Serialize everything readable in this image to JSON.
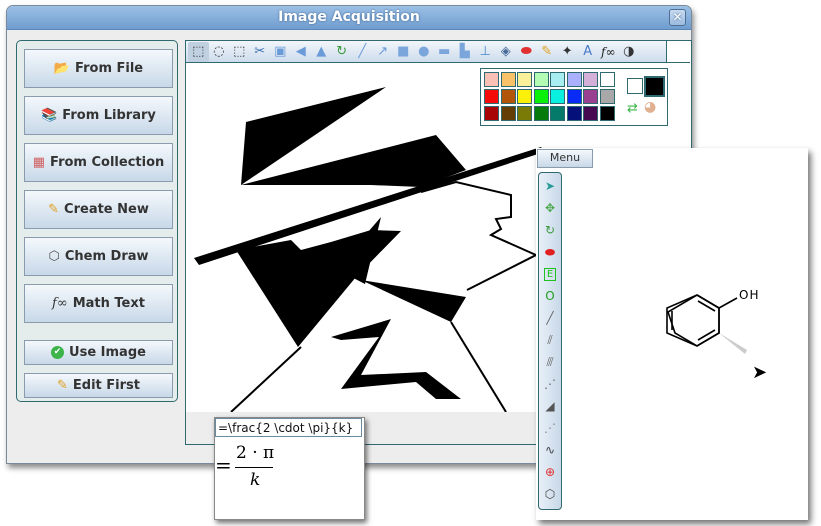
{
  "window": {
    "title": "Image Acquisition",
    "close_icon": "close-icon"
  },
  "left_panel": {
    "buttons": [
      {
        "label": "From File",
        "icon": "folder-file-icon"
      },
      {
        "label": "From Library",
        "icon": "books-icon"
      },
      {
        "label": "From Collection",
        "icon": "color-grid-icon"
      },
      {
        "label": "Create New",
        "icon": "pencil-icon"
      },
      {
        "label": "Chem Draw",
        "icon": "benzene-ring-icon"
      },
      {
        "label": "Math Text",
        "icon": "function-icon"
      },
      {
        "label": "Use Image",
        "icon": "check-circle-icon"
      },
      {
        "label": "Edit First",
        "icon": "pencil-icon"
      }
    ],
    "icon_glyphs": {
      "from_file": "📂",
      "from_library": "📚",
      "from_collection": "▦",
      "create_new": "✎",
      "chem_draw": "⬡",
      "math_text": "f∞",
      "use_image": "✔",
      "edit_first": "✎"
    }
  },
  "image_toolbar": {
    "tools": [
      {
        "name": "rectangle-select",
        "glyph": "⬚",
        "selected": true
      },
      {
        "name": "ellipse-select",
        "glyph": "◌"
      },
      {
        "name": "free-select",
        "glyph": "⬚"
      },
      {
        "name": "cut",
        "glyph": "✂"
      },
      {
        "name": "crop",
        "glyph": "▣"
      },
      {
        "name": "flip-horizontal",
        "glyph": "◀"
      },
      {
        "name": "flip-vertical",
        "glyph": "▲"
      },
      {
        "name": "rotate",
        "glyph": "↻"
      },
      {
        "name": "line",
        "glyph": "╱"
      },
      {
        "name": "arrow",
        "glyph": "↗"
      },
      {
        "name": "rectangle",
        "glyph": "■"
      },
      {
        "name": "ellipse",
        "glyph": "●"
      },
      {
        "name": "rounded-rectangle",
        "glyph": "▬"
      },
      {
        "name": "polygon",
        "glyph": "▙"
      },
      {
        "name": "stamp",
        "glyph": "⊥"
      },
      {
        "name": "fill-bucket",
        "glyph": "◈"
      },
      {
        "name": "eraser",
        "glyph": "⬬"
      },
      {
        "name": "pencil",
        "glyph": "✎"
      },
      {
        "name": "magic-wand",
        "glyph": "✦"
      },
      {
        "name": "add-text",
        "glyph": "A"
      },
      {
        "name": "math-text",
        "glyph": "f∞"
      },
      {
        "name": "contrast",
        "glyph": "◑"
      }
    ]
  },
  "palette": {
    "colors": [
      [
        "#f9c1b5",
        "#f9c168",
        "#faf09a",
        "#b3fcb3",
        "#a8eef0",
        "#aab0fa",
        "#d4b0d8",
        "#ffffff"
      ],
      [
        "#f50a0a",
        "#b25509",
        "#faf00a",
        "#0af00a",
        "#0af0e0",
        "#0a2af5",
        "#9a4090",
        "#a8a8a8"
      ],
      [
        "#a80606",
        "#643c05",
        "#7a7a06",
        "#067a0a",
        "#067a6a",
        "#06107a",
        "#460a50",
        "#000000"
      ]
    ],
    "foreground": "#ffffff",
    "background": "#000000",
    "swap_icon": "swap-colors-icon",
    "palette_icon": "color-palette-icon"
  },
  "math_popup": {
    "input_value": "=\\frac{2 \\cdot \\pi}{k}",
    "rendered_prefix": "=",
    "rendered_numerator": "2 · π",
    "rendered_denominator": "k"
  },
  "chem_editor": {
    "menu_label": "Menu",
    "tools": [
      {
        "name": "select-arrow",
        "glyph": "➤",
        "color": "#2a9a9a"
      },
      {
        "name": "move",
        "glyph": "✥",
        "color": "#4aa84a"
      },
      {
        "name": "rotate",
        "glyph": "↻",
        "color": "#3a9a3a"
      },
      {
        "name": "eraser",
        "glyph": "⬬",
        "color": "#e02020"
      },
      {
        "name": "element",
        "glyph": "E",
        "color": "#20c020"
      },
      {
        "name": "oxygen-group",
        "glyph": "O",
        "color": "#20a020"
      },
      {
        "name": "single-bond",
        "glyph": "╱",
        "color": "#666"
      },
      {
        "name": "double-bond",
        "glyph": "⫽",
        "color": "#666"
      },
      {
        "name": "triple-bond",
        "glyph": "⫻",
        "color": "#666"
      },
      {
        "name": "dotted-bond",
        "glyph": "⋰",
        "color": "#666"
      },
      {
        "name": "wedge-bond",
        "glyph": "◢",
        "color": "#555"
      },
      {
        "name": "hash-bond",
        "glyph": "⋰",
        "color": "#888"
      },
      {
        "name": "wavy-bond",
        "glyph": "∿",
        "color": "#444"
      },
      {
        "name": "charge",
        "glyph": "⊕",
        "color": "#e03030"
      },
      {
        "name": "ring",
        "glyph": "⬡",
        "color": "#444"
      }
    ],
    "molecule": {
      "substituent_label": "OH"
    }
  }
}
